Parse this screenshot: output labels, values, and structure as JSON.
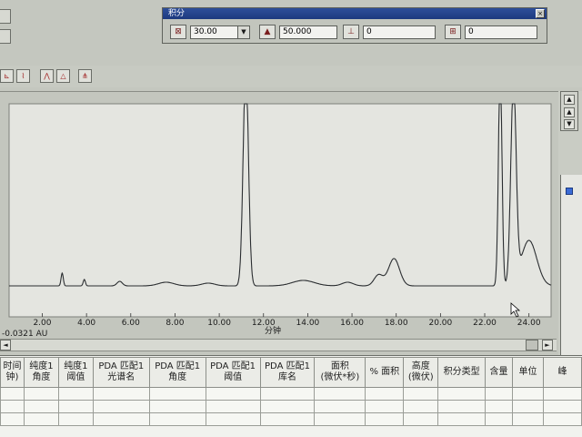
{
  "integration_toolbar": {
    "title": "积分",
    "close_glyph": "×",
    "field1_value": "30.00",
    "field2_value": "50.000",
    "field3_value": "0",
    "field4_value": "0",
    "dropdown_glyph": "▼",
    "icons": [
      "peak-width-icon",
      "threshold-icon",
      "min-area-icon",
      "min-height-icon"
    ]
  },
  "chart_data": {
    "type": "line",
    "xlabel": "分钟",
    "ylabel": "",
    "title": "",
    "baseline_label": "-0.0321 AU",
    "xlim": [
      0.5,
      25.0
    ],
    "ylim": [
      0,
      1
    ],
    "x_ticks": [
      "2.00",
      "4.00",
      "6.00",
      "8.00",
      "10.00",
      "12.00",
      "14.00",
      "16.00",
      "18.00",
      "20.00",
      "22.00",
      "24.00"
    ],
    "x_tick_values": [
      2,
      4,
      6,
      8,
      10,
      12,
      14,
      16,
      18,
      20,
      22,
      24
    ],
    "peaks": [
      {
        "rt": 2.9,
        "height": 0.07,
        "width": 0.05
      },
      {
        "rt": 3.9,
        "height": 0.035,
        "width": 0.05
      },
      {
        "rt": 5.5,
        "height": 0.025,
        "width": 0.12
      },
      {
        "rt": 7.6,
        "height": 0.02,
        "width": 0.35
      },
      {
        "rt": 9.5,
        "height": 0.015,
        "width": 0.3
      },
      {
        "rt": 11.2,
        "height": 1.2,
        "width": 0.12
      },
      {
        "rt": 13.8,
        "height": 0.03,
        "width": 0.5
      },
      {
        "rt": 15.8,
        "height": 0.02,
        "width": 0.25
      },
      {
        "rt": 17.2,
        "height": 0.06,
        "width": 0.2
      },
      {
        "rt": 17.9,
        "height": 0.15,
        "width": 0.25
      },
      {
        "rt": 22.7,
        "height": 1.2,
        "width": 0.08
      },
      {
        "rt": 23.3,
        "height": 1.1,
        "width": 0.12
      },
      {
        "rt": 24.0,
        "height": 0.25,
        "width": 0.35
      }
    ],
    "grid": false,
    "legend": "none"
  },
  "scroll": {
    "left_glyph": "◄",
    "right_glyph": "►",
    "up_glyph": "▲",
    "down_glyph": "▼"
  },
  "table": {
    "columns": [
      "时间\n钟)",
      "纯度1\n角度",
      "纯度1\n阈值",
      "PDA 匹配1\n光谱名",
      "PDA 匹配1\n角度",
      "PDA 匹配1\n阈值",
      "PDA 匹配1\n库名",
      "面积\n(微伏*秒)",
      "% 面积",
      "高度\n(微伏)",
      "积分类型",
      "含量",
      "单位",
      "峰"
    ],
    "rows": [
      [],
      [],
      []
    ]
  },
  "colors": {
    "trace": "#2a2d30",
    "window_title": "#1d3a7f",
    "background": "#c9ccc4"
  }
}
